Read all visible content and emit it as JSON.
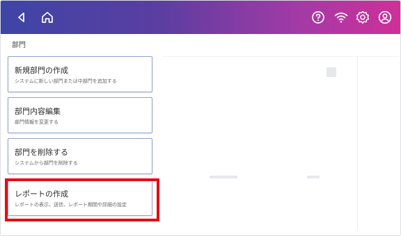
{
  "topbar": {
    "icons": [
      "back-icon",
      "home-icon",
      "help-icon",
      "wifi-icon",
      "settings-icon",
      "account-icon"
    ],
    "colors": {
      "start": "#3e45a6",
      "end": "#cf2f98"
    }
  },
  "section": {
    "title": "部門"
  },
  "cards": [
    {
      "title": "新規部門の作成",
      "subtitle": "システムに新しい部門または中部門を追加する"
    },
    {
      "title": "部門内容編集",
      "subtitle": "部門情報を変更する"
    },
    {
      "title": "部門を削除する",
      "subtitle": "システムから部門を削除する"
    },
    {
      "title": "レポートの作成",
      "subtitle": "レポートの表示、送信、レポート期間や詳細の設定"
    }
  ],
  "highlight_color": "#e60c14"
}
